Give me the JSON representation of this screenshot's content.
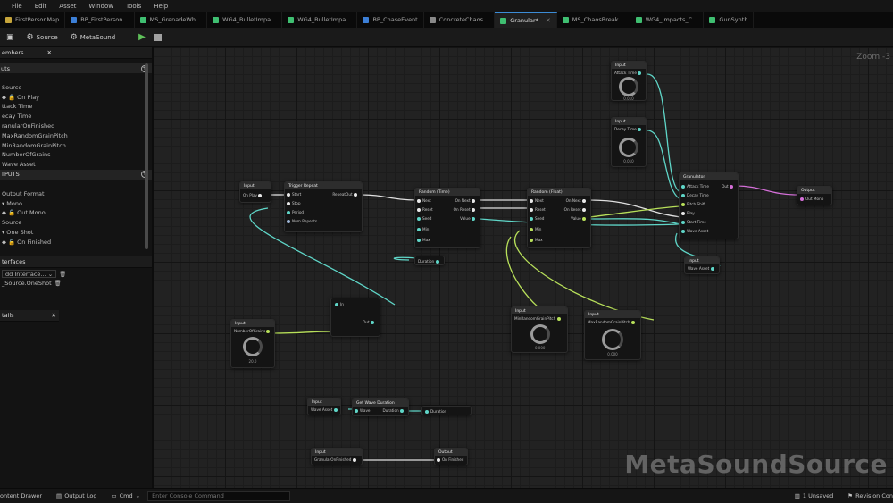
{
  "menu": [
    "File",
    "Edit",
    "Asset",
    "Window",
    "Tools",
    "Help"
  ],
  "tabs": [
    {
      "label": "FirstPersonMap",
      "color": "#c7a63b"
    },
    {
      "label": "BP_FirstPerson...",
      "color": "#3c7fd6"
    },
    {
      "label": "MS_GrenadeWh...",
      "color": "#3fbf71"
    },
    {
      "label": "WG4_BulletImpa...",
      "color": "#3fbf71"
    },
    {
      "label": "WG4_BulletImpa...",
      "color": "#3fbf71"
    },
    {
      "label": "BP_ChaseEvent",
      "color": "#3c7fd6"
    },
    {
      "label": "ConcreteChaos...",
      "color": "#888888"
    },
    {
      "label": "Granular*",
      "color": "#3fbf71",
      "active": true
    },
    {
      "label": "MS_ChaosBreak...",
      "color": "#3fbf71"
    },
    {
      "label": "WG4_Impacts_C...",
      "color": "#3fbf71"
    },
    {
      "label": "GunSynth",
      "color": "#3fbf71"
    }
  ],
  "toolbar": {
    "source": "Source",
    "metasound": "MetaSound"
  },
  "members_panel": {
    "title": "embers",
    "inputs_header": "uts",
    "inputs": [
      "",
      "Source",
      "On Play",
      "ttack Time",
      "ecay Time",
      "ranularOnFinished",
      "MaxRandomGrainPitch",
      "MinRandomGrainPitch",
      "NumberOfGrains",
      "Wave Asset"
    ],
    "outputs_header": "TPUTS",
    "outputs": [
      "",
      "Output Format",
      "Mono",
      "Out Mono",
      "Source",
      "One Shot",
      "On Finished"
    ]
  },
  "interfaces_panel": {
    "title": "terfaces",
    "dropdown": "dd Interface...",
    "item": "_Source.OneShot"
  },
  "details_panel": {
    "title": "tails"
  },
  "graph": {
    "zoom": "Zoom -3",
    "watermark": "MetaSoundSource",
    "nodes": {
      "in_onplay": {
        "head": "Input",
        "pin": "On Play"
      },
      "trigger_repeat": {
        "head": "Trigger Repeat",
        "pins_in": [
          "Start",
          "Stop",
          "Period",
          "Num Repeats"
        ],
        "pins_out": [
          "RepeatOut"
        ]
      },
      "random_time": {
        "head": "Random (Time)",
        "pins_in": [
          "Next",
          "Reset",
          "Seed",
          "Min",
          "Max"
        ],
        "pins_out": [
          "On Next",
          "On Reset",
          "Value"
        ]
      },
      "random_float": {
        "head": "Random (Float)",
        "pins_in": [
          "Next",
          "Reset",
          "Seed",
          "Min",
          "Max"
        ],
        "pins_out": [
          "On Next",
          "On Reset",
          "Value"
        ]
      },
      "duration": {
        "head": "",
        "pin": "Duration"
      },
      "attack_time": {
        "head": "Input",
        "pin": "Attack Time",
        "value": "0.010"
      },
      "decay_time": {
        "head": "Input",
        "pin": "Decay Time",
        "value": "0.010"
      },
      "granulator": {
        "head": "Granulator",
        "pins_in": [
          "Attack Time",
          "Decay Time",
          "Pitch Shift",
          "Play",
          "Start Time",
          "Wave Asset"
        ],
        "pins_out": [
          "Out"
        ]
      },
      "out_mono": {
        "head": "Output",
        "pin": "Out Mono"
      },
      "wave_asset": {
        "head": "Input",
        "pin": "Wave Asset"
      },
      "num_grains": {
        "head": "Input",
        "pin": "NumberOfGrains",
        "value": "20.0"
      },
      "multiply": {
        "head": "",
        "pins": [
          "In",
          "Out"
        ]
      },
      "min_pitch": {
        "head": "Input",
        "pin": "MinRandomGrainPitch",
        "value": "-0.000"
      },
      "max_pitch": {
        "head": "Input",
        "pin": "MaxRandomGrainPitch",
        "value": "0.000"
      },
      "in_wave2": {
        "head": "Input",
        "pin": "Wave Asset"
      },
      "get_duration": {
        "head": "Get Wave Duration",
        "pin_in": "Wave",
        "pin_out": "Duration"
      },
      "duration_out": {
        "head": "",
        "pin": "Duration"
      },
      "in_finished": {
        "head": "Input",
        "pin": "GranularOnFinished"
      },
      "out_finished": {
        "head": "Output",
        "pin": "On Finished"
      }
    }
  },
  "status": {
    "content_drawer": "ontent Drawer",
    "output_log": "Output Log",
    "cmd": "Cmd",
    "console_placeholder": "Enter Console Command",
    "unsaved": "1 Unsaved",
    "revision": "Revision Con"
  },
  "colors": {
    "wire_white": "#e0e0e0",
    "wire_teal": "#5fd6c8",
    "wire_green": "#b8e05a",
    "wire_pink": "#d46fd8",
    "accent_blue": "#3c8cd6"
  }
}
